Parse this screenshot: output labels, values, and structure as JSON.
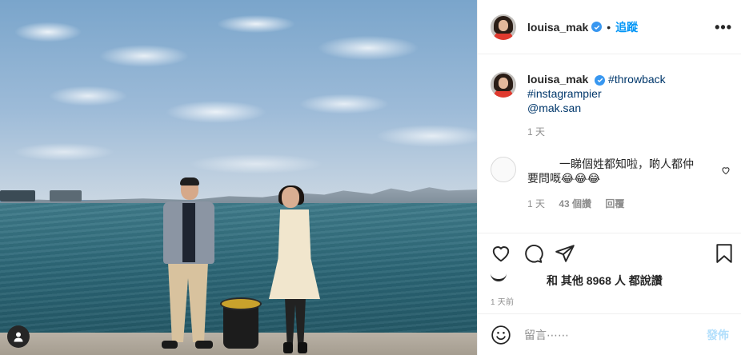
{
  "post": {
    "username": "louisa_mak",
    "follow_label": "追蹤",
    "dot": "•",
    "more": "•••"
  },
  "caption": {
    "username": "louisa_mak",
    "hashtag1": "#throwback",
    "hashtag2": "#instagrampier",
    "mention": "@mak.san",
    "time": "1 天"
  },
  "comment": {
    "text": "一睇個姓都知啦，啲人都仲要問嘅😂😂😂",
    "time": "1 天",
    "likes": "43 個讚",
    "reply": "回覆"
  },
  "likes": {
    "text": "和 其他 8968 人 都說讚"
  },
  "post_time": "1 天前",
  "add_comment": {
    "placeholder": "留言⋯⋯",
    "post_label": "發佈"
  },
  "colors": {
    "verified": "#3897f0",
    "follow": "#0095f6",
    "post_disabled": "#b2dffc"
  },
  "icons": [
    "verified-badge-icon",
    "more-options-icon",
    "heart-icon",
    "comment-icon",
    "share-icon",
    "bookmark-icon",
    "emoji-icon",
    "user-tag-icon"
  ]
}
